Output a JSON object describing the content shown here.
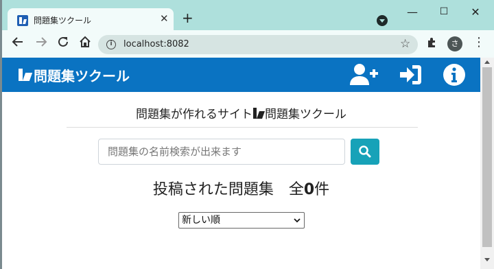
{
  "browser": {
    "tab_title": "問題集ツクール",
    "tab_close": "✕",
    "new_tab": "+",
    "url": "localhost:8082",
    "profile_initial": "さ",
    "controls": {
      "minimize": "—",
      "maximize": "☐",
      "close": "✕"
    },
    "icons": [
      "back-icon",
      "forward-icon",
      "reload-icon",
      "home-icon",
      "info-icon",
      "bookmark-star-icon",
      "extensions-icon",
      "menu-dots-icon"
    ]
  },
  "navbar": {
    "brand": "問題集ツクール",
    "background": "#0a73c2",
    "icons": [
      "user-plus-icon",
      "sign-in-icon",
      "info-circle-icon"
    ]
  },
  "main": {
    "subtitle_prefix": "問題集が作れるサイト",
    "subtitle_suffix": "問題集ツクール",
    "search_placeholder": "問題集の名前検索が出来ます",
    "search_button_color": "#17a2b8",
    "count_prefix": "投稿された問題集　全",
    "count_value": "0",
    "count_suffix": "件",
    "sort_selected": "新しい順"
  }
}
